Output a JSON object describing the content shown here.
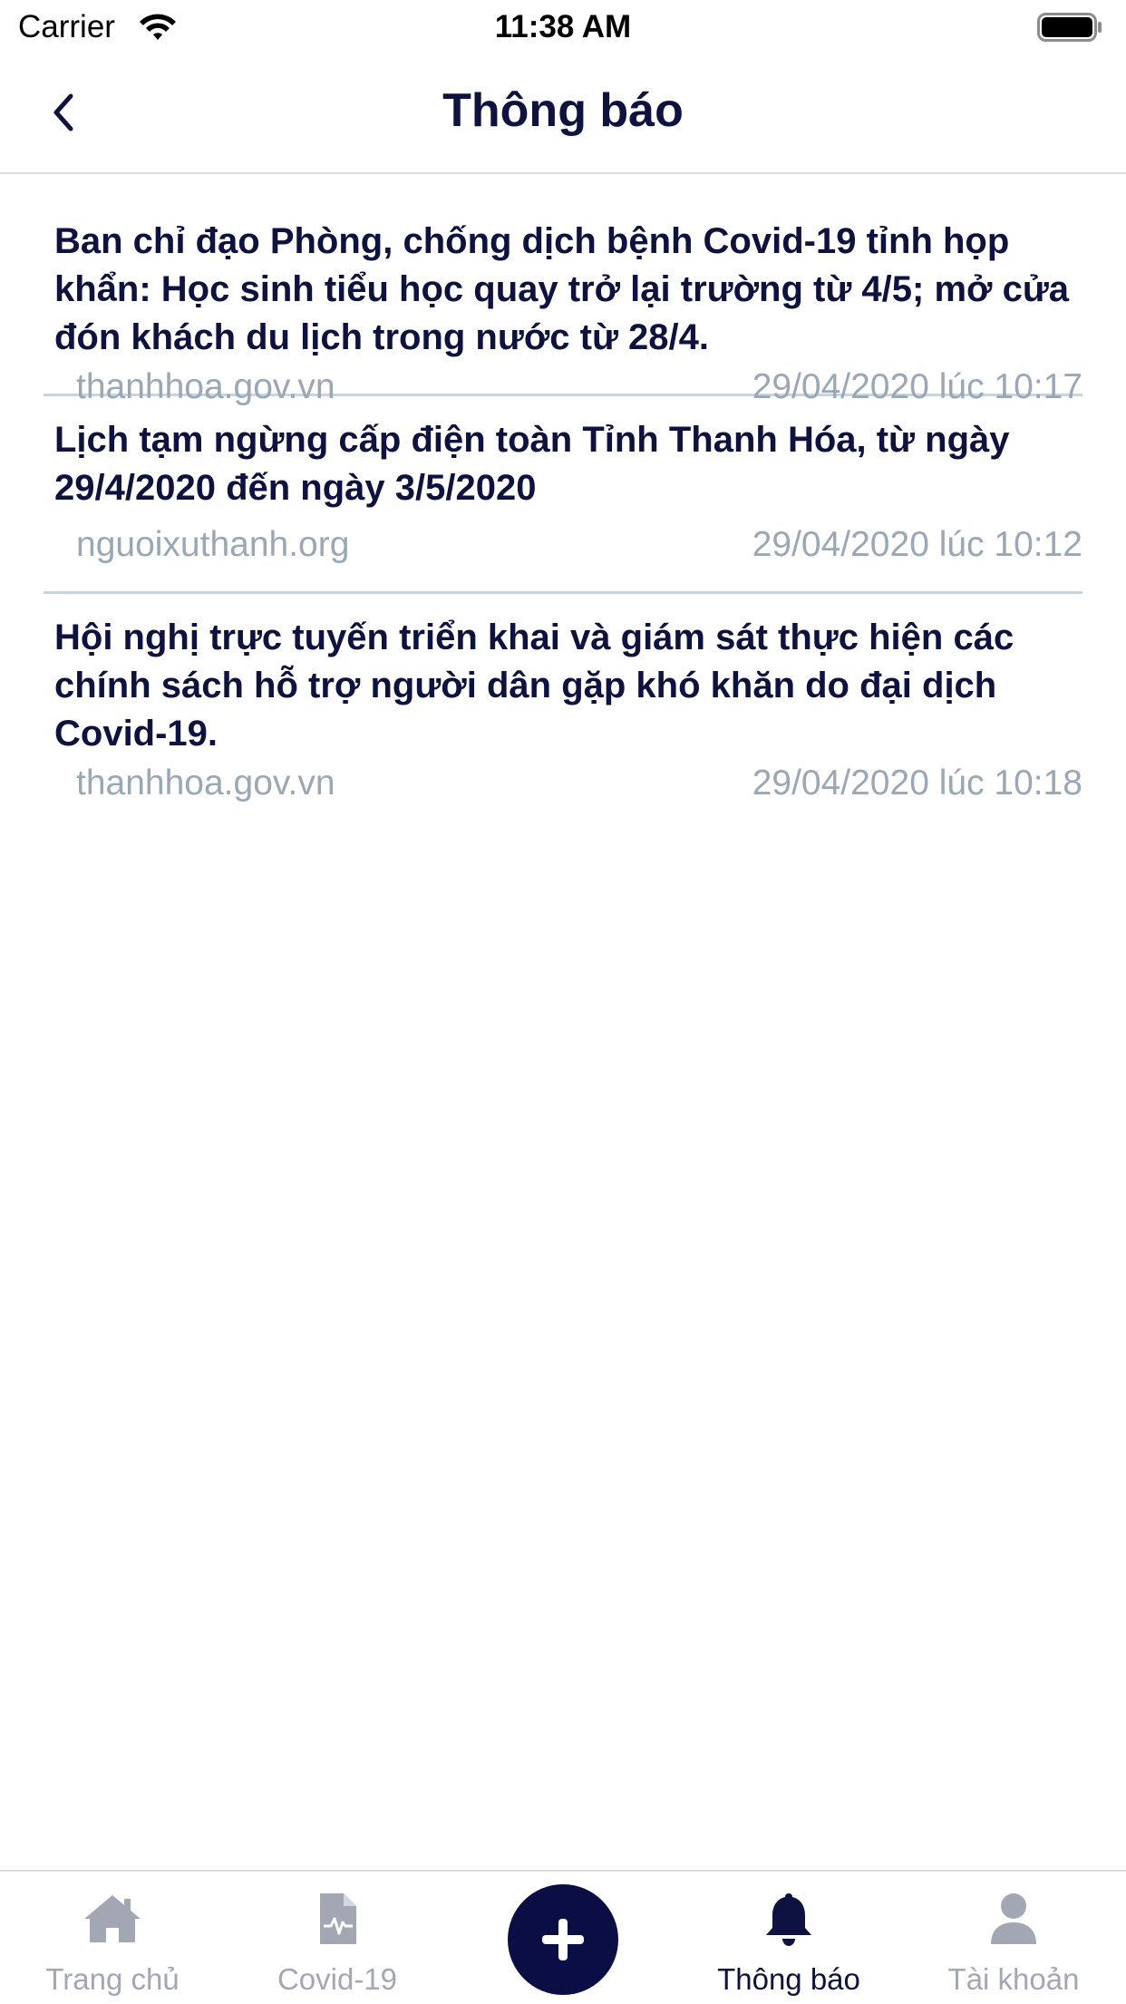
{
  "status_bar": {
    "carrier": "Carrier",
    "time": "11:38 AM",
    "wifi_icon": "wifi-icon",
    "battery_icon": "battery-icon"
  },
  "header": {
    "back_icon": "chevron-left-icon",
    "title": "Thông báo"
  },
  "notifications": [
    {
      "title": "Ban chỉ đạo Phòng, chống dịch bệnh Covid-19 tỉnh họp khẩn: Học sinh tiểu học quay trở lại trường từ 4/5; mở cửa đón khách du lịch trong nước từ 28/4.",
      "source": "thanhhoa.gov.vn",
      "time": "29/04/2020 lúc 10:17"
    },
    {
      "title": "Lịch tạm ngừng cấp điện toàn Tỉnh Thanh Hóa, từ ngày 29/4/2020 đến ngày 3/5/2020",
      "source": "nguoixuthanh.org",
      "time": "29/04/2020 lúc 10:12"
    },
    {
      "title": "Hội nghị trực tuyến triển khai và giám sát thực hiện các chính sách hỗ trợ người dân gặp khó khăn do đại dịch Covid-19.",
      "source": "thanhhoa.gov.vn",
      "time": "29/04/2020 lúc 10:18"
    }
  ],
  "tab_bar": {
    "tabs": [
      {
        "label": "Trang chủ",
        "icon": "home-icon",
        "active": false
      },
      {
        "label": "Covid-19",
        "icon": "medical-file-icon",
        "active": false
      },
      {
        "label": "Thông báo",
        "icon": "bell-icon",
        "active": true
      },
      {
        "label": "Tài khoản",
        "icon": "user-icon",
        "active": false
      }
    ],
    "fab_icon": "plus-icon"
  },
  "colors": {
    "primary": "#0e1240",
    "fab": "#0b0d45",
    "meta_text": "#9aa7b6",
    "inactive_tab": "#a3a7b3",
    "divider": "#c9d4df"
  }
}
